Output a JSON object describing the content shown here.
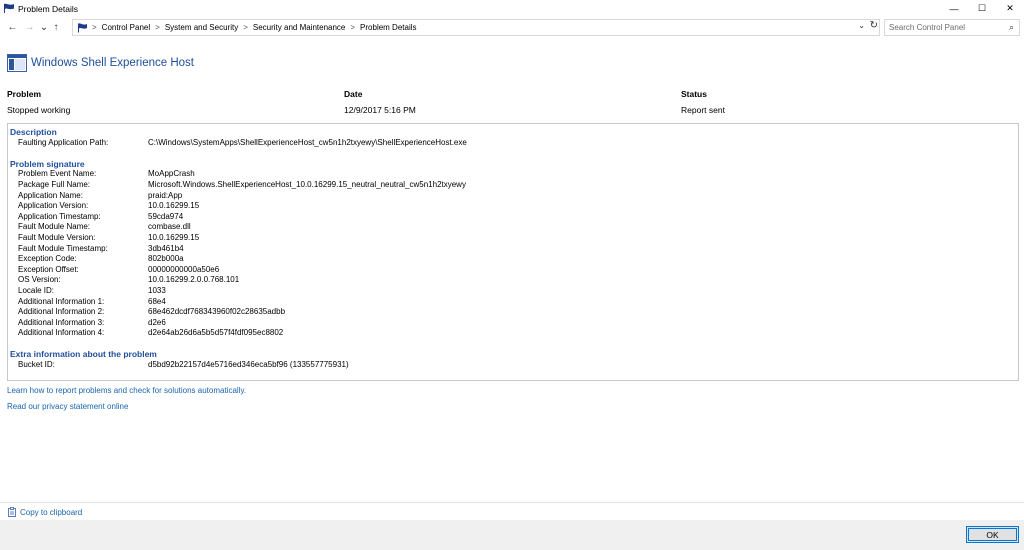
{
  "window": {
    "title": "Problem Details",
    "controls": {
      "minimize": "—",
      "maximize": "☐",
      "close": "✕"
    }
  },
  "address": {
    "back": "←",
    "forward": "→",
    "recent": "⌄",
    "up": "↑",
    "breadcrumb": [
      "Control Panel",
      "System and Security",
      "Security and Maintenance",
      "Problem Details"
    ],
    "separator": ">",
    "dropdown": "⌄",
    "refresh": "↻",
    "search_placeholder": "Search Control Panel",
    "search_icon": "⌕"
  },
  "header": {
    "title": "Windows Shell Experience Host"
  },
  "summary": {
    "problem_label": "Problem",
    "problem_value": "Stopped working",
    "date_label": "Date",
    "date_value": "12/9/2017 5:16 PM",
    "status_label": "Status",
    "status_value": "Report sent"
  },
  "description": {
    "title": "Description",
    "rows": [
      {
        "label": "Faulting Application Path:",
        "value": "C:\\Windows\\SystemApps\\ShellExperienceHost_cw5n1h2txyewy\\ShellExperienceHost.exe"
      }
    ]
  },
  "signature": {
    "title": "Problem signature",
    "rows": [
      {
        "label": "Problem Event Name:",
        "value": "MoAppCrash"
      },
      {
        "label": "Package Full Name:",
        "value": "Microsoft.Windows.ShellExperienceHost_10.0.16299.15_neutral_neutral_cw5n1h2txyewy"
      },
      {
        "label": "Application Name:",
        "value": "praid:App"
      },
      {
        "label": "Application Version:",
        "value": "10.0.16299.15"
      },
      {
        "label": "Application Timestamp:",
        "value": "59cda974"
      },
      {
        "label": "Fault Module Name:",
        "value": "combase.dll"
      },
      {
        "label": "Fault Module Version:",
        "value": "10.0.16299.15"
      },
      {
        "label": "Fault Module Timestamp:",
        "value": "3db461b4"
      },
      {
        "label": "Exception Code:",
        "value": "802b000a"
      },
      {
        "label": "Exception Offset:",
        "value": "00000000000a50e6"
      },
      {
        "label": "OS Version:",
        "value": "10.0.16299.2.0.0.768.101"
      },
      {
        "label": "Locale ID:",
        "value": "1033"
      },
      {
        "label": "Additional Information 1:",
        "value": "68e4"
      },
      {
        "label": "Additional Information 2:",
        "value": "68e462dcdf768343960f02c28635adbb"
      },
      {
        "label": "Additional Information 3:",
        "value": "d2e6"
      },
      {
        "label": "Additional Information 4:",
        "value": "d2e64ab26d6a5b5d57f4fdf095ec8802"
      }
    ]
  },
  "extra": {
    "title": "Extra information about the problem",
    "rows": [
      {
        "label": "Bucket ID:",
        "value": "d5bd92b22157d4e5716ed346eca5bf96 (133557775931)"
      }
    ]
  },
  "links": {
    "learn": "Learn how to report problems and check for solutions automatically.",
    "privacy": "Read our privacy statement online"
  },
  "footer": {
    "copy": "Copy to clipboard",
    "ok": "OK"
  },
  "colors": {
    "link": "#1a64b0",
    "section_title": "#1f4e9c",
    "ok_border": "#0078d7"
  }
}
